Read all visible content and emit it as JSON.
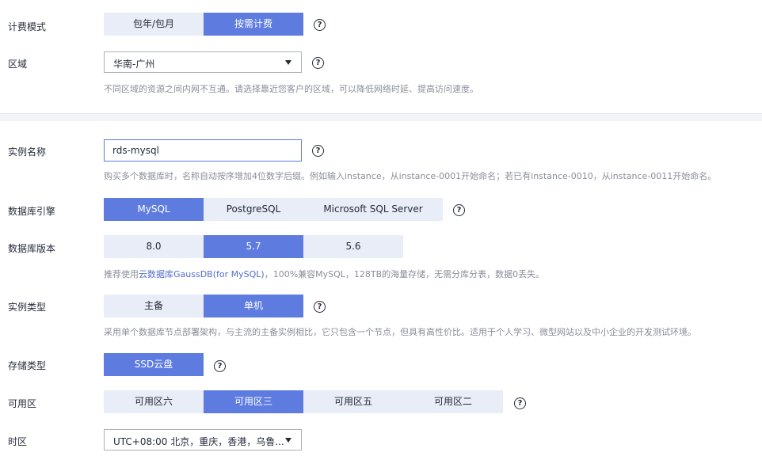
{
  "billing": {
    "label": "计费模式",
    "options": [
      "包年/包月",
      "按需计费"
    ],
    "selected": "按需计费"
  },
  "region": {
    "label": "区域",
    "value": "华南-广州",
    "hint": "不同区域的资源之间内网不互通。请选择靠近您客户的区域，可以降低网络时延、提高访问速度。"
  },
  "instance_name": {
    "label": "实例名称",
    "value": "rds-mysql",
    "hint": "购买多个数据库时，名称自动按序增加4位数字后缀。例如输入instance，从instance-0001开始命名；若已有instance-0010，从instance-0011开始命名。"
  },
  "engine": {
    "label": "数据库引擎",
    "options": [
      "MySQL",
      "PostgreSQL",
      "Microsoft SQL Server"
    ],
    "selected": "MySQL"
  },
  "version": {
    "label": "数据库版本",
    "options": [
      "8.0",
      "5.7",
      "5.6"
    ],
    "selected": "5.7",
    "hint_prefix": "推荐使用",
    "hint_link": "云数据库GaussDB(for MySQL)",
    "hint_suffix": "，100%兼容MySQL，128TB的海量存储，无需分库分表，数据0丢失。"
  },
  "instance_type": {
    "label": "实例类型",
    "options": [
      "主备",
      "单机"
    ],
    "selected": "单机",
    "hint": "采用单个数据库节点部署架构，与主流的主备实例相比，它只包含一个节点，但具有高性价比。适用于个人学习、微型网站以及中小企业的开发测试环境。"
  },
  "storage": {
    "label": "存储类型",
    "options": [
      "SSD云盘"
    ],
    "selected": "SSD云盘"
  },
  "az": {
    "label": "可用区",
    "options": [
      "可用区六",
      "可用区三",
      "可用区五",
      "可用区二"
    ],
    "selected": "可用区三"
  },
  "timezone": {
    "label": "时区",
    "value": "UTC+08:00 北京，重庆，香港，乌鲁..."
  },
  "help_glyph": "?",
  "colors": {
    "accent": "#5e7ce0",
    "option_bg": "#e8edf7",
    "hint": "#8a8e99",
    "link": "#526ecc"
  }
}
